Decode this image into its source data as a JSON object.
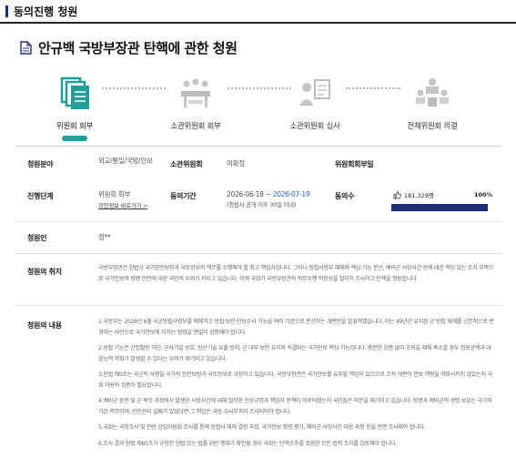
{
  "header": {
    "section_title": "동의진행 청원"
  },
  "page": {
    "title": "안규백 국방부장관 탄핵에 관한 청원"
  },
  "steps": [
    {
      "label": "위원회 회부",
      "active": true
    },
    {
      "label": "소관위원회 회부",
      "active": false
    },
    {
      "label": "소관위원회 심사",
      "active": false
    },
    {
      "label": "전체위원회 의결",
      "active": false
    }
  ],
  "info": {
    "field_label": "청원분야",
    "field_value": "외교/통일/국방/안보",
    "committee_label": "소관위원회",
    "committee_value": "미확정",
    "referral_label": "위원회회부일",
    "referral_value": "",
    "stage_label": "진행단계",
    "stage_value": "위원회 회부",
    "stage_link": "의안정보 바로가기 >",
    "period_label": "동의기간",
    "period_start": "2026-06-18 ~ ",
    "period_end": "2026-07-19",
    "period_note": "(청원서 공개 이후 30일 이내)",
    "agree_label": "동의수",
    "agree_count": "181,329명",
    "agree_percent_text": "100%",
    "agree_fraction": 1.0,
    "petitioner_label": "청원인",
    "petitioner_value": "정**",
    "purpose_label": "청원의 취지",
    "purpose_text": "국방부장관은 헌법상 국가안전보장과 국토방위의 책무를 수행해야 할 최고 책임자입니다. 그러나 방첩사령부 해체와 핵심 기능 분산, 예비군 사망사건 등에 대한 책임 있는 조치 부족으로 국가안보와 장병 안전에 대한 국민적 우려가 커지고 있습니다. 이에 국회가 국방부장관의 직무수행 적정성을 철저히 조사하고 탄핵을 청원합니다",
    "content_label": "청원의 내용",
    "content_paragraphs": [
      "1.국방부는 2026년 6월 국군방첩사령부를 해체하고 방첩·보안·안보수사 기능을 여러 기관으로 분산하는 개편안을 발표하였습니다. 이는 49년간 유지된 군 방첩 체계를 근본적으로 변경하는 사안으로 국가안보에 미치는 영향을 면밀히 검증해야 합니다.",
      "2.방첩 기능은 간첩활동 차단, 군사기밀 보호, 방산기술 유출 방지, 군 내부 보안 유지와 직결되는 국가안보 핵심 기능입니다. 충분한 검증 없이 조직을 해체·축소할 경우 정보공백과 대응능력 약화가 발생할 수 있다는 우려가 제기되고 있습니다.",
      "3.헌법 제5조는 국군의 사명을 국가의 안전보장과 국토방위로 규정하고 있습니다. 국방부장관은 국가안보를 유지할 책임이 있으므로 조직 개편이 안보 역량을 약화시키지 않았는지 국회 차원의 검증이 필요합니다.",
      "4.예비군 훈련 및 군 복무 과정에서 발생한 사망사건에 대해 철저한 진상규명과 책임자 문책이 이루어졌는지 국민들은 의문을 제기하고 있습니다. 장병과 예비군의 생명 보호는 국가의 기본 책무이며, 안전관리 실패가 있었다면 그 책임은 국방 수뇌부까지 조사되어야 합니다.",
      "5.국회는 국정조사 및 관련 상임위원회 조사를 통해 방첩사 해체 결정 과정, 국가안보 영향 평가, 예비군 사망사건 대응 과정 등을 전면 조사해야 합니다.",
      "6.조사 결과 헌법 제65조가 규정한 헌법 또는 법률 위반 행위가 확인될 경우 국회는 탄핵소추를 포함한 모든 법적 조치를 검토해야 합니다."
    ]
  },
  "colors": {
    "accent": "#1f9f97",
    "navy": "#1e2f78",
    "link_blue": "#2a63c8"
  }
}
